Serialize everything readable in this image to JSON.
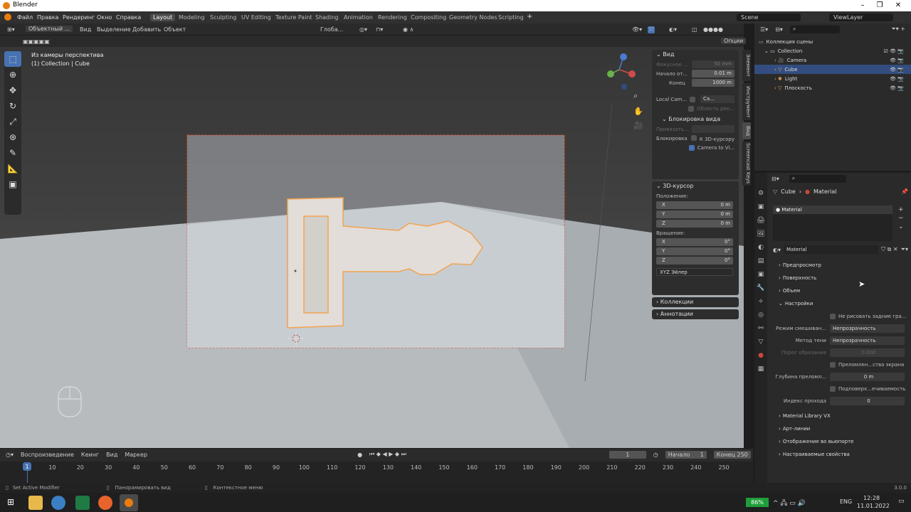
{
  "app": {
    "title": "Blender"
  },
  "menus": [
    "Файл",
    "Правка",
    "Рендеринг",
    "Окно",
    "Справка"
  ],
  "workspaces": [
    "Layout",
    "Modeling",
    "Sculpting",
    "UV Editing",
    "Texture Paint",
    "Shading",
    "Animation",
    "Rendering",
    "Compositing",
    "Geometry Nodes",
    "Scripting"
  ],
  "active_workspace": "Layout",
  "scene": {
    "name": "Scene",
    "viewlayer": "ViewLayer"
  },
  "viewport_header": {
    "mode": "Объектный ...",
    "items": [
      "Вид",
      "Выделение",
      "Добавить",
      "Объект"
    ],
    "transform": "Глоба...",
    "options": "Опции"
  },
  "viewport": {
    "line1": "Из камеры перспектива",
    "line2": "(1) Collection | Cube"
  },
  "npanel": {
    "view_header": "Вид",
    "focal_label": "Фокусное ...",
    "focal_value": "50 mm",
    "clip_start_label": "Начало от...",
    "clip_start_value": "0.01 m",
    "clip_end_label": "Конец",
    "clip_end_value": "1000 m",
    "local_cam_label": "Local Cam...",
    "local_cam_value": "Ca...",
    "render_region": "Область рен...",
    "lock_header": "Блокировка вида",
    "lock_to_label": "Привязать...",
    "lock_label": "Блокировка",
    "lock_cursor": "К 3D-курсору",
    "camera_to_view": "Camera to Vi...",
    "cursor_header": "3D-курсор",
    "location_label": "Положение:",
    "x_label": "X",
    "x_value": "0 m",
    "y_label": "Y",
    "y_value": "0 m",
    "z_label": "Z",
    "z_value": "0 m",
    "rotation_label": "Вращение:",
    "rx_value": "0°",
    "ry_value": "0°",
    "rz_value": "0°",
    "rotation_mode": "XYZ Эйлер",
    "collections": "Коллекции",
    "annotations": "Аннотации"
  },
  "vtabs": [
    "Элемент",
    "Инструмент",
    "Вид",
    "Screencast Keys"
  ],
  "outliner": {
    "root": "Коллекция сцены",
    "collection": "Collection",
    "items": [
      "Camera",
      "Cube",
      "Light",
      "Плоскость"
    ]
  },
  "properties": {
    "breadcrumb_object": "Cube",
    "breadcrumb_material": "Material",
    "slot": "Material",
    "material_name": "Material",
    "sections": [
      "Предпросмотр",
      "Поверхность",
      "Объем",
      "Настройки"
    ],
    "backface": "Не рисовать задние гра...",
    "blend_label": "Режим смешиван...",
    "blend_value": "Непрозрачность",
    "shadow_label": "Метод тени",
    "shadow_value": "Непрозрачность",
    "clip_label": "Порог обрезания",
    "clip_value": "0.000",
    "refraction": "Преломлен...ства экрана",
    "refr_depth_label": "Глубина преломл...",
    "refr_depth_value": "0 m",
    "sss": "Подповерх...ечиваемость",
    "pass_label": "Индекс прохода",
    "pass_value": "0",
    "bottom_sections": [
      "Material Library VX",
      "Арт-линии",
      "Отображение во вьюпорте",
      "Настраиваемые свойства"
    ]
  },
  "timeline": {
    "playback": "Воспроизведение",
    "keying": "Кеинг",
    "view": "Вид",
    "marker": "Маркер",
    "current": "1",
    "start_label": "Начало",
    "start": "1",
    "end_label": "Конец",
    "end": "250",
    "ticks": [
      "1",
      "10",
      "20",
      "30",
      "40",
      "50",
      "60",
      "70",
      "80",
      "90",
      "100",
      "110",
      "120",
      "130",
      "140",
      "150",
      "160",
      "170",
      "180",
      "190",
      "200",
      "210",
      "220",
      "230",
      "240",
      "250"
    ]
  },
  "statusbar": {
    "left": "Set Active Modifier",
    "mid": "Панорамировать вид",
    "right": "Контекстное меню",
    "version": "3.0.0"
  },
  "taskbar": {
    "battery": "86%",
    "lang": "ENG",
    "time": "12:28",
    "date": "11.01.2022"
  }
}
